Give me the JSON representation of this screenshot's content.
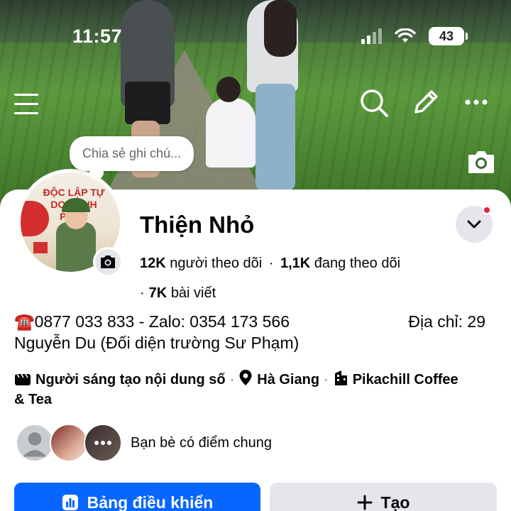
{
  "status_bar": {
    "time": "11:57",
    "battery": "43"
  },
  "cover": {
    "note_placeholder": "Chia sẻ ghi chú..."
  },
  "profile": {
    "name": "Thiện Nhỏ",
    "avatar_banner_text": "ĐỘC LẬP TỰ DO HẠNH PHÚC",
    "stats": {
      "followers_count": "12K",
      "followers_label": "người theo dõi",
      "following_count": "1,1K",
      "following_label": "đang theo dõi",
      "posts_count": "7K",
      "posts_label": "bài viết"
    },
    "bio_line1": "☎️0877 033 833 - Zalo: 0354 173 566",
    "bio_address": "Địa chỉ: 29",
    "bio_line2": "Nguyễn Du (Đối diện trường Sư Phạm)",
    "category": "Người sáng tạo nội dung số",
    "location": "Hà Giang",
    "workplace_line1": "Pikachill Coffee",
    "workplace_line2": "& Tea"
  },
  "mutual": {
    "label": "Bạn bè có điểm chung"
  },
  "actions": {
    "dashboard_label": "Bảng điều khiển",
    "create_label": "Tạo"
  },
  "colors": {
    "primary": "#0866ff",
    "secondary_bg": "#e4e6eb",
    "notification_dot": "#e41e3f"
  },
  "icons": [
    "menu-icon",
    "search-icon",
    "pencil-icon",
    "more-icon",
    "camera-icon",
    "chevron-down-icon",
    "clapperboard-icon",
    "location-pin-icon",
    "building-icon",
    "dashboard-icon",
    "plus-icon"
  ]
}
